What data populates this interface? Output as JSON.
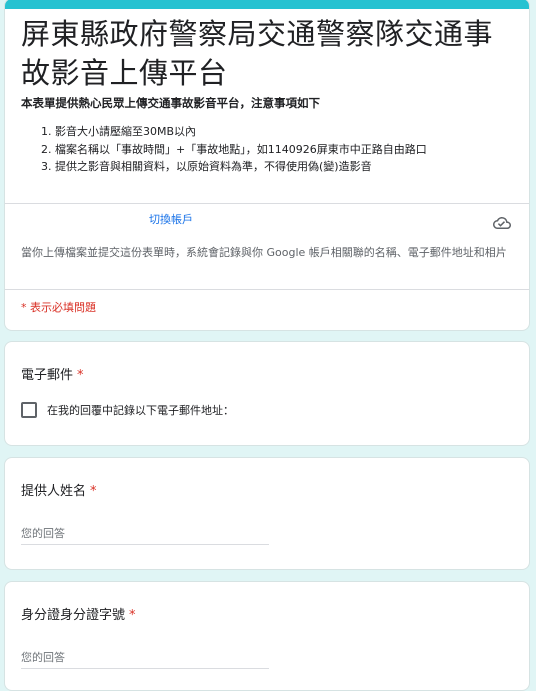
{
  "form": {
    "title": "屏東縣政府警察局交通警察隊交通事故影音上傳平台",
    "intro": "本表單提供熱心民眾上傳交通事故影音平台，注意事項如下",
    "rules": [
      {
        "num": "1.",
        "text": "影音大小請壓縮至30MB以內"
      },
      {
        "num": "2.",
        "text": "檔案名稱以「事故時間」+「事故地點」，如1140926屏東市中正路自由路口"
      },
      {
        "num": "3.",
        "text": "提供之影音與相關資料，以原始資料為準，不得使用偽(變)造影音"
      }
    ],
    "switch_account": "切換帳戶",
    "notice": "當你上傳檔案並提交這份表單時，系統會記錄與你 Google 帳戶相關聯的名稱、電子郵件地址和相片",
    "required_note": "* 表示必填問題"
  },
  "questions": {
    "email": {
      "title": "電子郵件",
      "required": "*",
      "checkbox_label": "在我的回覆中記錄以下電子郵件地址："
    },
    "name": {
      "title": "提供人姓名",
      "required": "*",
      "placeholder": "您的回答"
    },
    "id": {
      "title": "身分證身分證字號",
      "required": "*",
      "placeholder": "您的回答"
    }
  },
  "icons": {
    "cloud": "cloud-check-icon"
  },
  "colors": {
    "background": "#e0f5f5",
    "accent": "#26c2d1",
    "link": "#1a73e8",
    "required": "#d93025"
  }
}
